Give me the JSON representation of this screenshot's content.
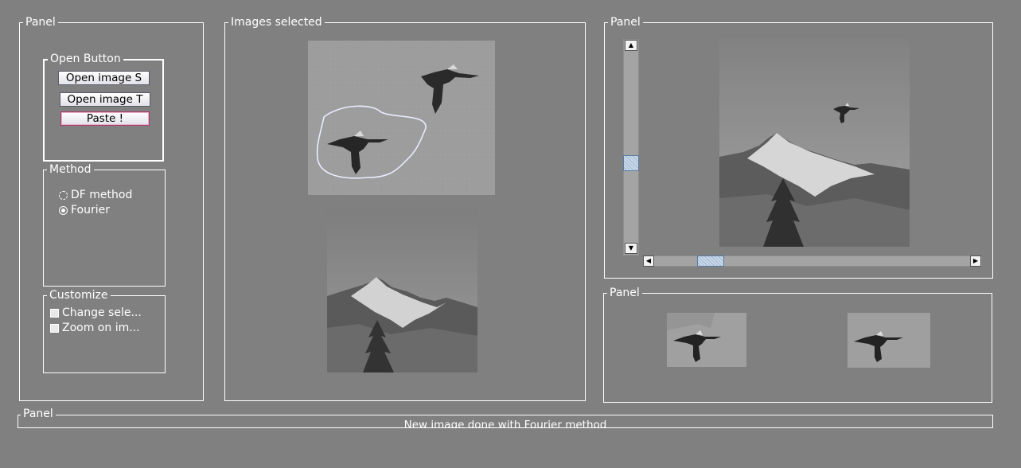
{
  "left_panel": {
    "title": "Panel",
    "open_group": {
      "title": "Open Button",
      "open_source_label": "Open image S",
      "open_target_label": "Open image T",
      "paste_label": "Paste !"
    },
    "method_group": {
      "title": "Method",
      "options": [
        "DF method",
        "Fourier"
      ],
      "selected": "Fourier"
    },
    "customize_group": {
      "title": "Customize",
      "options": [
        "Change sele...",
        "Zoom on im..."
      ]
    }
  },
  "center_panel": {
    "title": "Images selected"
  },
  "right_top_panel": {
    "title": "Panel"
  },
  "right_bottom_panel": {
    "title": "Panel"
  },
  "bottom_panel": {
    "title": "Panel",
    "status_text": "New image  done with Fourier method"
  },
  "colors": {
    "background": "#808080",
    "border": "#ffffff",
    "selection_outline": "#9fa8ff",
    "focus_border": "#b03a70"
  },
  "icons": [
    "up-arrow-icon",
    "down-arrow-icon",
    "left-arrow-icon",
    "right-arrow-icon"
  ]
}
